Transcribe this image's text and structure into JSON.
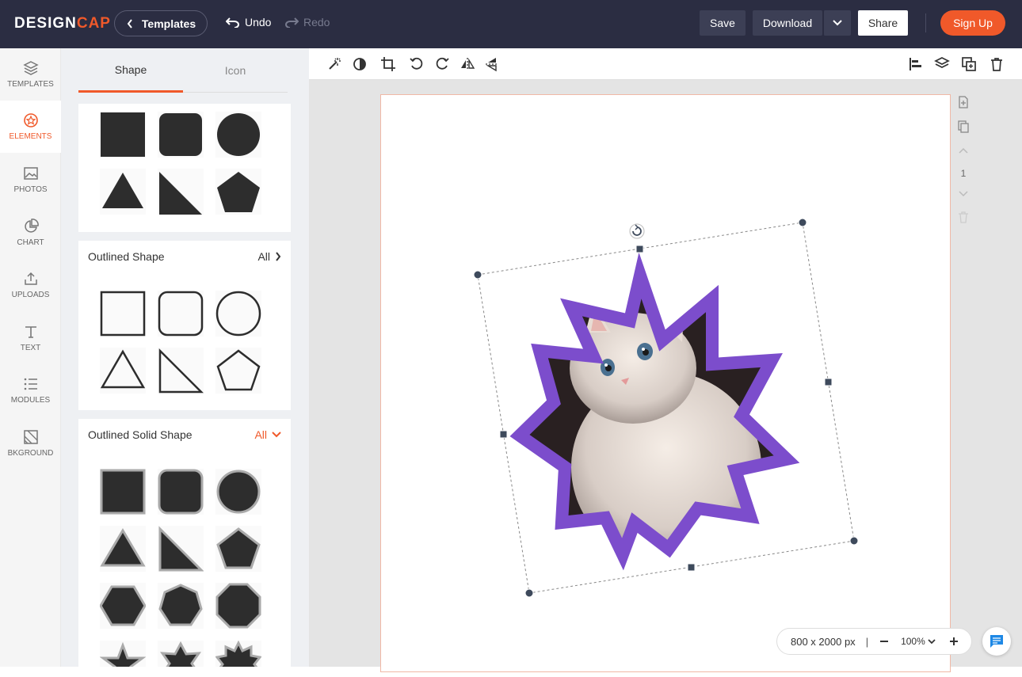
{
  "app": {
    "logo_main": "DESIGN",
    "logo_accent": "CAP",
    "templates_label": "Templates",
    "undo_label": "Undo",
    "redo_label": "Redo",
    "save_label": "Save",
    "download_label": "Download",
    "share_label": "Share",
    "signup_label": "Sign Up"
  },
  "nav": {
    "templates": "TEMPLATES",
    "elements": "ELEMENTS",
    "photos": "PHOTOS",
    "chart": "CHART",
    "uploads": "UPLOADS",
    "text": "TEXT",
    "modules": "MODULES",
    "background": "BKGROUND"
  },
  "panel": {
    "tab_shape": "Shape",
    "tab_icon": "Icon",
    "outlined_title": "Outlined Shape",
    "outlined_all": "All",
    "outlined_solid_title": "Outlined Solid Shape",
    "outlined_solid_all": "All"
  },
  "canvas": {
    "page_number": "1",
    "size_label": "800 x 2000 px",
    "zoom_label": "100%",
    "frame_color": "#7c4dcc"
  },
  "colors": {
    "topbar": "#2b2d42",
    "accent": "#f0592a"
  }
}
